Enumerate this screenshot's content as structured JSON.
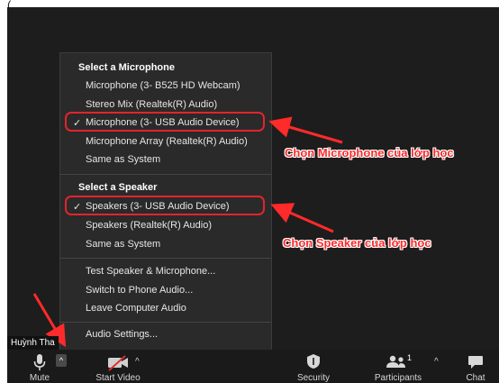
{
  "top_crop_text": "(",
  "menu": {
    "microphone_header": "Select a Microphone",
    "microphones": [
      {
        "label": "Microphone (3- B525 HD Webcam)"
      },
      {
        "label": "Stereo Mix (Realtek(R) Audio)"
      },
      {
        "label": "Microphone (3- USB Audio Device)",
        "selected": true
      },
      {
        "label": "Microphone Array (Realtek(R) Audio)"
      },
      {
        "label": "Same as System"
      }
    ],
    "speaker_header": "Select a Speaker",
    "speakers": [
      {
        "label": "Speakers (3- USB Audio Device)",
        "selected": true
      },
      {
        "label": "Speakers (Realtek(R) Audio)"
      },
      {
        "label": "Same as System"
      }
    ],
    "actions": [
      {
        "label": "Test Speaker & Microphone..."
      },
      {
        "label": "Switch to Phone Audio..."
      },
      {
        "label": "Leave Computer Audio"
      }
    ],
    "settings": "Audio Settings...",
    "check_glyph": "✓"
  },
  "annotations": {
    "microphone_note": "Chọn Microphone của lớp học",
    "speaker_note": "Chọn Speaker của lớp học",
    "color": "#ff2a2a"
  },
  "participant_name": "Huỳnh Tha",
  "toolbar": {
    "mute_label": "Mute",
    "start_video_label": "Start Video",
    "security_label": "Security",
    "participants_label": "Participants",
    "participants_count": "1",
    "chat_label": "Chat",
    "caret_glyph": "^"
  }
}
